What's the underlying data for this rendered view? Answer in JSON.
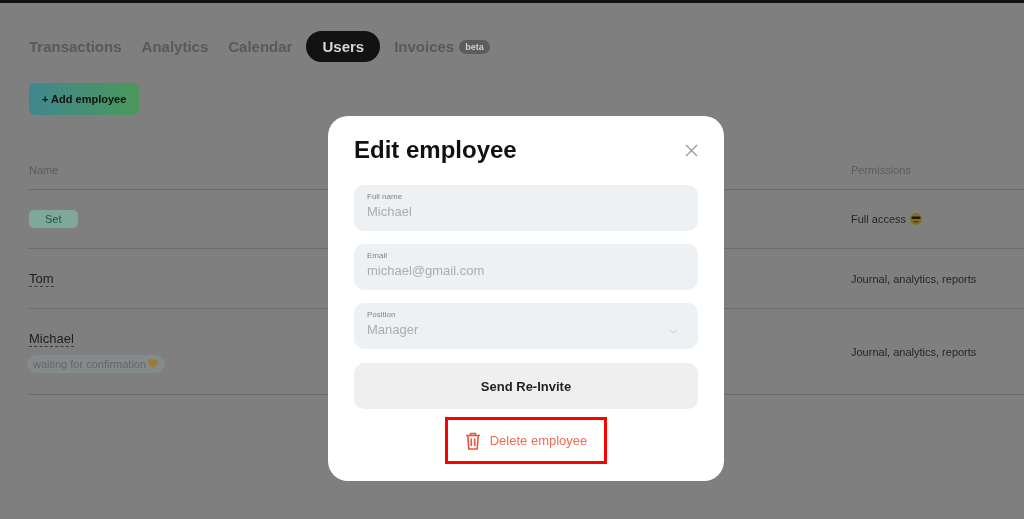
{
  "tabs": [
    {
      "label": "Transactions",
      "selected": false
    },
    {
      "label": "Analytics",
      "selected": false
    },
    {
      "label": "Calendar",
      "selected": false
    },
    {
      "label": "Users",
      "selected": true
    },
    {
      "label": "Invoices",
      "selected": false,
      "badge": "beta"
    }
  ],
  "add_button": {
    "label": "+ Add employee"
  },
  "table": {
    "columns": [
      "Name",
      "Permissions"
    ],
    "rows": [
      {
        "name": "Set",
        "kind": "tag",
        "permissions": "Full access",
        "permissions_emoji": true
      },
      {
        "name": "Tom",
        "kind": "name",
        "permissions": "Journal, analytics, reports"
      },
      {
        "name": "Michael",
        "kind": "name",
        "status": "waiting for confirmation",
        "status_emoji": true,
        "permissions": "Journal, analytics, reports"
      }
    ]
  },
  "modal": {
    "title": "Edit employee",
    "fields": [
      {
        "label": "Full name",
        "value": "Michael",
        "kind": "text"
      },
      {
        "label": "Email",
        "value": "michael@gmail.com",
        "kind": "text"
      },
      {
        "label": "Position",
        "value": "Manager",
        "kind": "select"
      }
    ],
    "primary_button": "Send Re-Invite",
    "delete_button": {
      "label": "Delete employee",
      "highlighted": true
    }
  }
}
